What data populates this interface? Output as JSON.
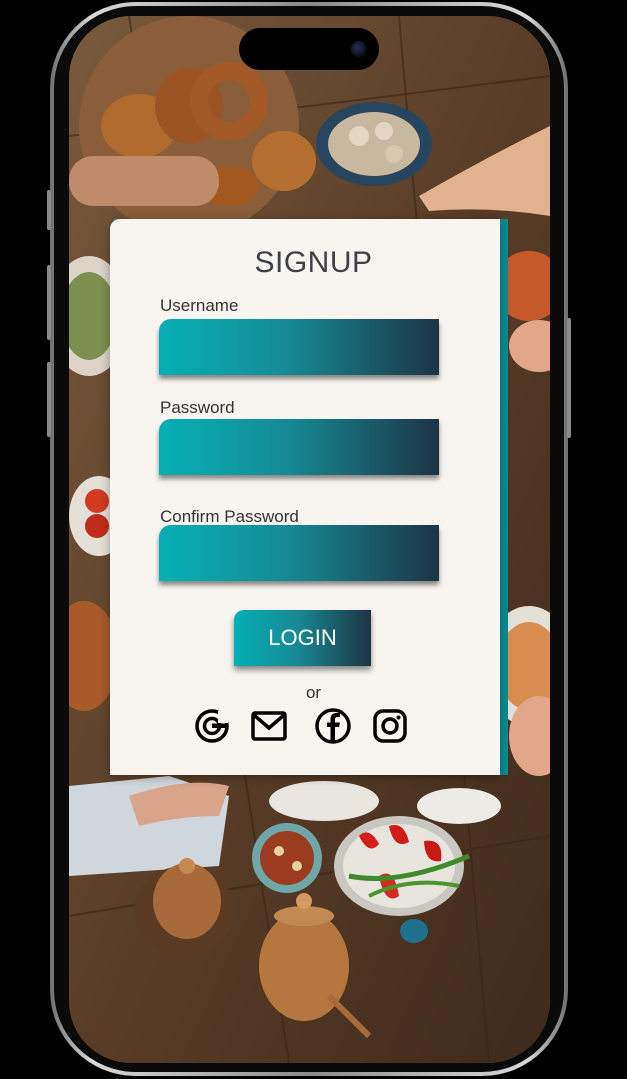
{
  "form": {
    "title": "SIGNUP",
    "username_label": "Username",
    "username_value": "",
    "password_label": "Password",
    "password_value": "",
    "confirm_label": "Confirm Password",
    "confirm_value": "",
    "login_label": "LOGIN",
    "or_text": "or"
  },
  "social": {
    "icons": [
      "google-icon",
      "mail-icon",
      "facebook-icon",
      "instagram-icon"
    ]
  },
  "colors": {
    "accent": "#0a8d93",
    "gradient_start": "#06b0b4",
    "gradient_end": "#1d3444",
    "card_bg": "#f8f5f0",
    "text": "#3f3f4a"
  }
}
